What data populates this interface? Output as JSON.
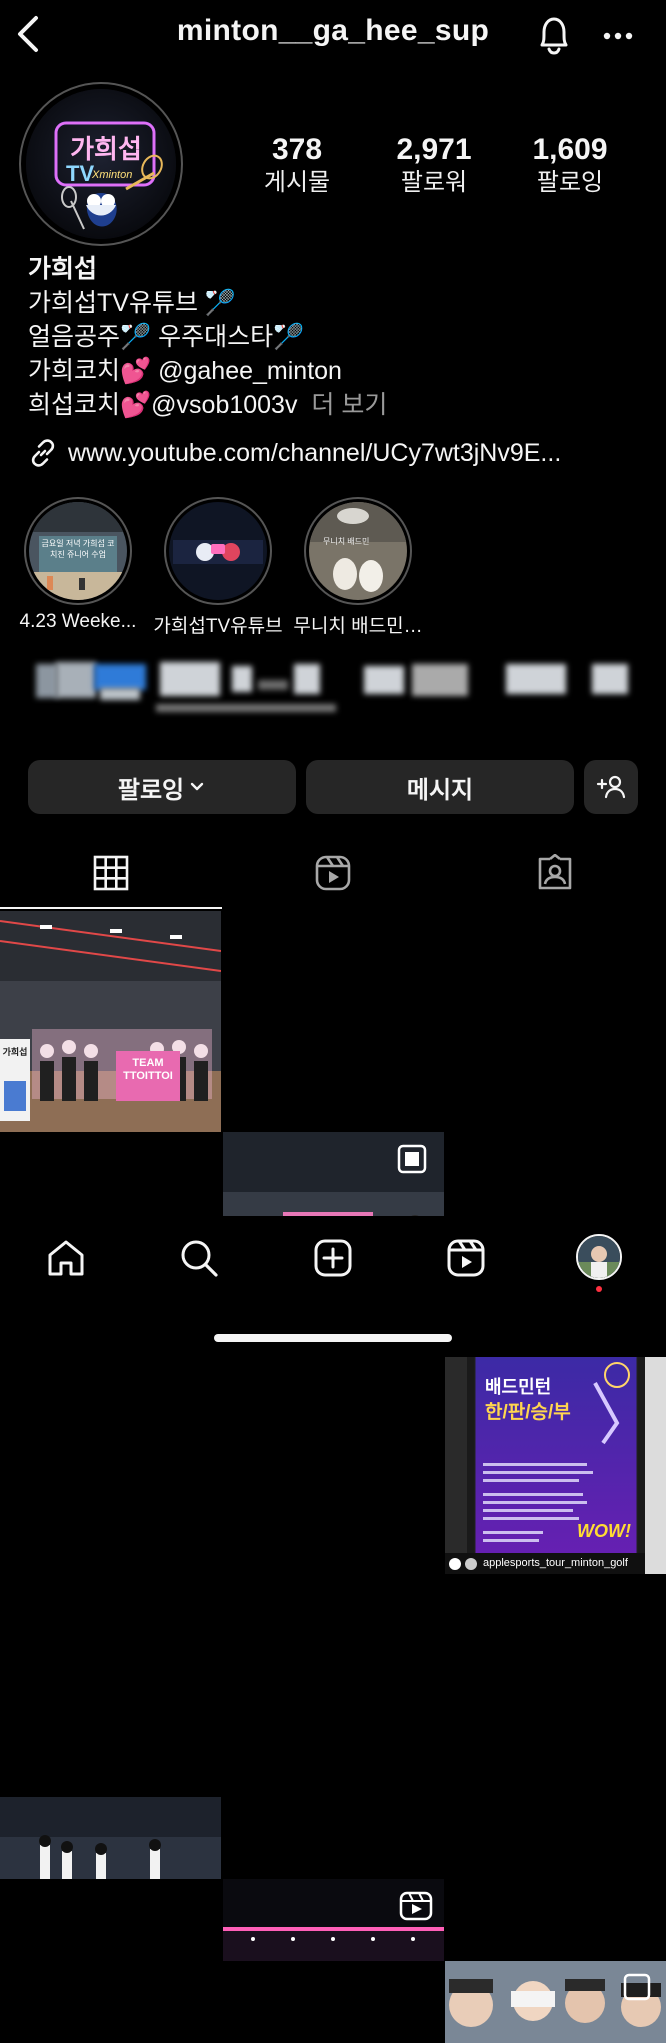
{
  "header": {
    "username": "minton__ga_hee_sup"
  },
  "profile": {
    "avatar_text": {
      "line1": "가희섭",
      "line2": "TV",
      "line3": "Xminton"
    },
    "stats": [
      {
        "value": "378",
        "label": "게시물"
      },
      {
        "value": "2,971",
        "label": "팔로워"
      },
      {
        "value": "1,609",
        "label": "팔로잉"
      }
    ]
  },
  "bio": {
    "name": "가희섭",
    "line1": "가희섭TV유튜브",
    "line2a": "얼음공주",
    "line2b": "우주대스타",
    "line3a": "가희코치",
    "line3b": "@gahee_minton",
    "line4a": "희섭코치",
    "line4b": "@vsob1003v",
    "more": "더 보기",
    "link": "www.youtube.com/channel/UCy7wt3jNv9E..."
  },
  "highlights": [
    {
      "caption": "4.23 Weeke...",
      "overlay": "금요일 저녁 가희섭 코치진 쥬니어 수업"
    },
    {
      "caption": "가희섭TV유튜브"
    },
    {
      "caption": "무니치 배드민…",
      "overlay": "무니치 배드민"
    }
  ],
  "buttons": {
    "following": "팔로잉",
    "message": "메시지"
  },
  "grid": {
    "post1_sign": "TEAM TTOITTOI",
    "post1_panel": "가희섭",
    "post3_title": "배드민턴",
    "post3_subtitle": "한/판/승/부",
    "post3_wow": "WOW!",
    "post3_tag": "applesports_tour_minton_golf"
  },
  "colors": {
    "accent": "#ff4fb5",
    "bg": "#000000",
    "button": "#262626",
    "notification": "#ff3040"
  },
  "icons": [
    "back-arrow-icon",
    "bell-icon",
    "more-icon",
    "link-icon",
    "chevron-down-icon",
    "add-person-icon",
    "grid-icon",
    "reels-icon",
    "tagged-icon",
    "home-icon",
    "search-icon",
    "create-icon",
    "reels-nav-icon",
    "profile-avatar-icon"
  ]
}
